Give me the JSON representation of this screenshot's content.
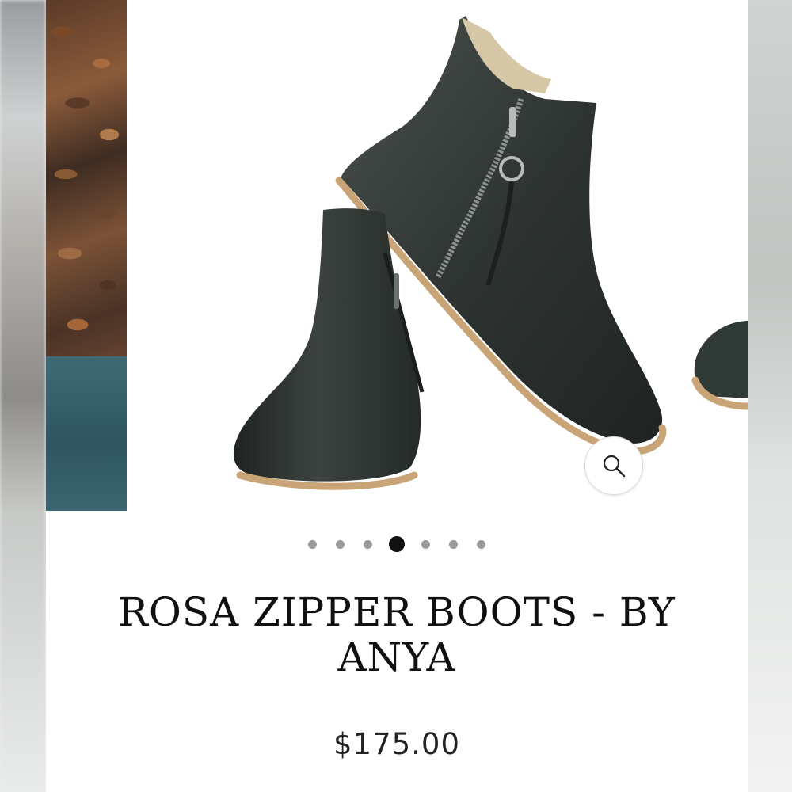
{
  "product": {
    "title": "ROSA ZIPPER BOOTS - BY ANYA",
    "price": "$175.00"
  },
  "gallery": {
    "slide_count": 7,
    "active_slide_index": 3,
    "zoom_icon": "search-icon"
  },
  "colors": {
    "leather": "#2d322f",
    "sole": "#c9a477",
    "active_dot": "#111111",
    "inactive_dot": "#9a9a9a"
  }
}
